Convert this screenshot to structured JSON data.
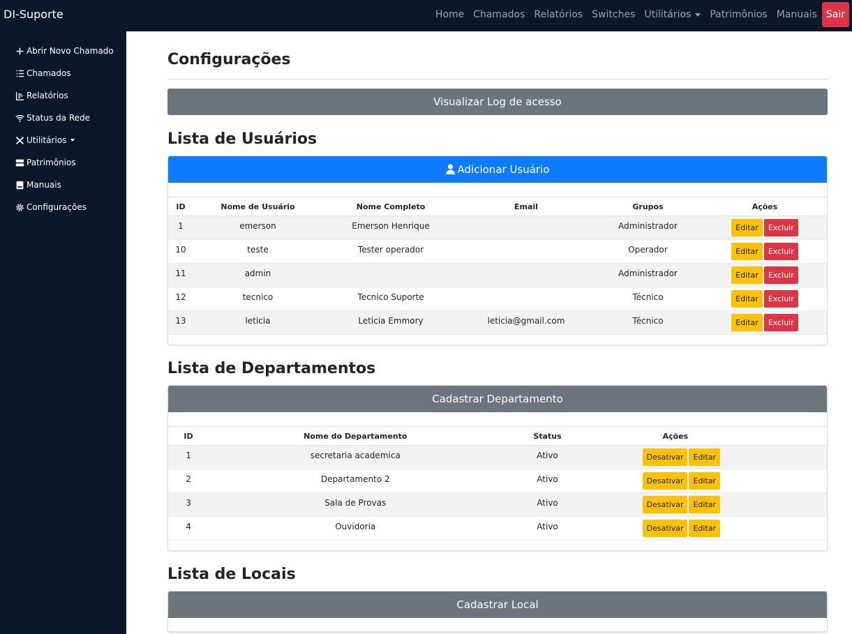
{
  "brand": "DI-Suporte",
  "topnav": {
    "links": [
      "Home",
      "Chamados",
      "Relatórios",
      "Switches",
      "Utilitários",
      "Patrimônios",
      "Manuais"
    ],
    "logout": "Sair"
  },
  "sidebar": {
    "items": [
      {
        "label": "Abrir Novo Chamado",
        "icon": "plus-icon"
      },
      {
        "label": "Chamados",
        "icon": "list-icon"
      },
      {
        "label": "Relatórios",
        "icon": "bar-chart-icon"
      },
      {
        "label": "Status da Rede",
        "icon": "wifi-icon"
      },
      {
        "label": "Utilitários",
        "icon": "tools-icon"
      },
      {
        "label": "Patrimônios",
        "icon": "server-icon"
      },
      {
        "label": "Manuais",
        "icon": "book-icon"
      },
      {
        "label": "Configurações",
        "icon": "gear-icon"
      }
    ]
  },
  "page": {
    "title": "Configurações",
    "log_button": "Visualizar Log de acesso"
  },
  "users": {
    "title": "Lista de Usuários",
    "add_button": "Adicionar Usuário",
    "columns": [
      "ID",
      "Nome de Usuário",
      "Nome Completo",
      "Email",
      "Grupos",
      "Ações"
    ],
    "rows": [
      {
        "id": "1",
        "username": "emerson",
        "fullname": "Emerson Henrique",
        "email": "",
        "group": "Administrador"
      },
      {
        "id": "10",
        "username": "teste",
        "fullname": "Tester operador",
        "email": "",
        "group": "Operador"
      },
      {
        "id": "11",
        "username": "admin",
        "fullname": "",
        "email": "",
        "group": "Administrador"
      },
      {
        "id": "12",
        "username": "tecnico",
        "fullname": "Tecnico Suporte",
        "email": "",
        "group": "Técnico"
      },
      {
        "id": "13",
        "username": "leticia",
        "fullname": "Leticia Emmory",
        "email": "leticia@gmail.com",
        "group": "Técnico"
      }
    ],
    "edit_label": "Editar",
    "delete_label": "Excluir"
  },
  "departments": {
    "title": "Lista de Departamentos",
    "add_button": "Cadastrar Departamento",
    "columns": [
      "ID",
      "Nome do Departamento",
      "Status",
      "Ações"
    ],
    "rows": [
      {
        "id": "1",
        "name": "secretaria academica",
        "status": "Ativo"
      },
      {
        "id": "2",
        "name": "Departamento 2",
        "status": "Ativo"
      },
      {
        "id": "3",
        "name": "Sala de Provas",
        "status": "Ativo"
      },
      {
        "id": "4",
        "name": "Ouvidoria",
        "status": "Ativo"
      }
    ],
    "deactivate_label": "Desativar",
    "edit_label": "Editar"
  },
  "locations": {
    "title": "Lista de Locais",
    "add_button": "Cadastrar Local"
  }
}
